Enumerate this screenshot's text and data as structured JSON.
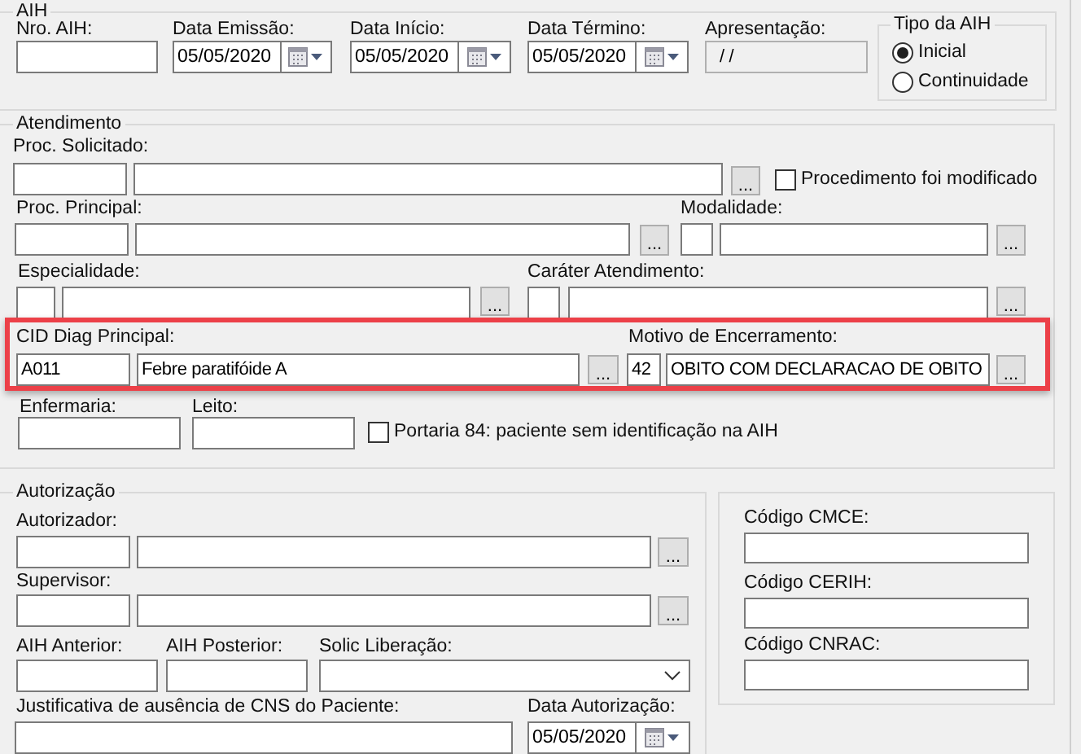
{
  "aih": {
    "title": "AIH",
    "nro_aih": {
      "label": "Nro. AIH:"
    },
    "data_emissao": {
      "label": "Data Emissão:",
      "value": "05/05/2020"
    },
    "data_inicio": {
      "label": "Data Início:",
      "value": "05/05/2020"
    },
    "data_termino": {
      "label": "Data Término:",
      "value": "05/05/2020"
    },
    "apresentacao": {
      "label": "Apresentação:",
      "value": "/ /",
      "disabled": true
    },
    "tipo_da_aih": {
      "title": "Tipo da AIH",
      "options": [
        {
          "label": "Inicial",
          "selected": true
        },
        {
          "label": "Continuidade",
          "selected": false
        }
      ]
    }
  },
  "atendimento": {
    "title": "Atendimento",
    "proc_solicitado": {
      "label": "Proc. Solicitado:",
      "button": "..."
    },
    "procedimento_foi_modificado": {
      "label": "Procedimento foi modificado",
      "checked": false
    },
    "proc_principal": {
      "label": "Proc. Principal:",
      "button": "..."
    },
    "modalidade": {
      "label": "Modalidade:",
      "button": "..."
    },
    "especialidade": {
      "label": "Especialidade:",
      "button": "..."
    },
    "carater_atendimento": {
      "label": "Caráter Atendimento:",
      "button": "..."
    },
    "highlighted_row": {
      "highlighted": true,
      "cid_diag_principal": {
        "label": "CID Diag Principal:",
        "code": "A011",
        "description": "Febre paratifóide A",
        "button": "..."
      },
      "motivo_de_encerramento": {
        "label": "Motivo de Encerramento:",
        "code": "42",
        "description": "OBITO COM DECLARACAO DE OBITO",
        "button": "..."
      }
    },
    "enfermaria": {
      "label": "Enfermaria:"
    },
    "leito": {
      "label": "Leito:"
    },
    "portaria_84": {
      "label": "Portaria 84: paciente sem identificação na AIH",
      "checked": false
    }
  },
  "autorizacao": {
    "title": "Autorização",
    "autorizador": {
      "label": "Autorizador:",
      "button": "..."
    },
    "supervisor": {
      "label": "Supervisor:",
      "button": "..."
    },
    "aih_anterior": {
      "label": "AIH Anterior:"
    },
    "aih_posterior": {
      "label": "AIH Posterior:"
    },
    "solic_liberacao": {
      "label": "Solic Liberação:"
    },
    "justificativa_ausencia_cns": {
      "label": "Justificativa de ausência de CNS do Paciente:"
    },
    "data_autorizacao": {
      "label": "Data Autorização:",
      "value": "05/05/2020"
    }
  },
  "codigos": [
    {
      "label": "Código CMCE:"
    },
    {
      "label": "Código CERIH:"
    },
    {
      "label": "Código CNRAC:"
    }
  ]
}
